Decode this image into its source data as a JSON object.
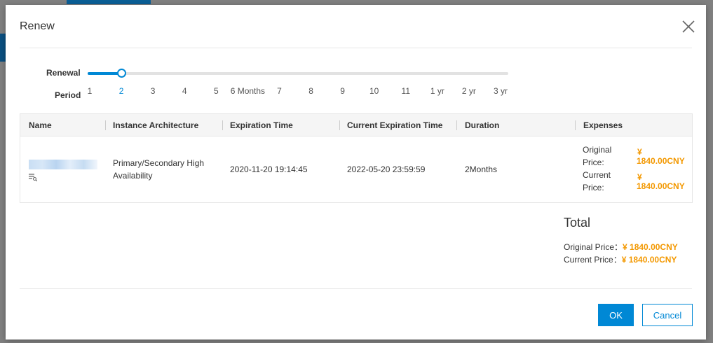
{
  "dialog": {
    "title": "Renew"
  },
  "renewal": {
    "label_line1": "Renewal",
    "label_line2": "Period",
    "selected_index": 1,
    "options": [
      "1",
      "2",
      "3",
      "4",
      "5",
      "6 Months",
      "7",
      "8",
      "9",
      "10",
      "11",
      "1 yr",
      "2 yr",
      "3 yr"
    ]
  },
  "table": {
    "headers": {
      "name": "Name",
      "architecture": "Instance Architecture",
      "expiration": "Expiration Time",
      "current_expiration": "Current Expiration Time",
      "duration": "Duration",
      "expenses": "Expenses"
    },
    "row": {
      "architecture": "Primary/Secondary High Availability",
      "expiration": "2020-11-20 19:14:45",
      "current_expiration": "2022-05-20 23:59:59",
      "duration": "2Months",
      "original_price_label_1": "Original",
      "original_price_label_2": "Price:",
      "original_price_value_1": "¥",
      "original_price_value_2": "1840.00CNY",
      "current_price_label_1": "Current",
      "current_price_label_2": "Price:",
      "current_price_value_1": "¥",
      "current_price_value_2": "1840.00CNY",
      "name_icon": "list-search-icon"
    }
  },
  "total": {
    "title": "Total",
    "original_label": "Original Price：",
    "original_value": "¥ 1840.00CNY",
    "current_label": "Current Price：",
    "current_value": "¥ 1840.00CNY"
  },
  "buttons": {
    "ok": "OK",
    "cancel": "Cancel"
  },
  "colors": {
    "accent": "#0088d5",
    "price": "#f39800"
  }
}
